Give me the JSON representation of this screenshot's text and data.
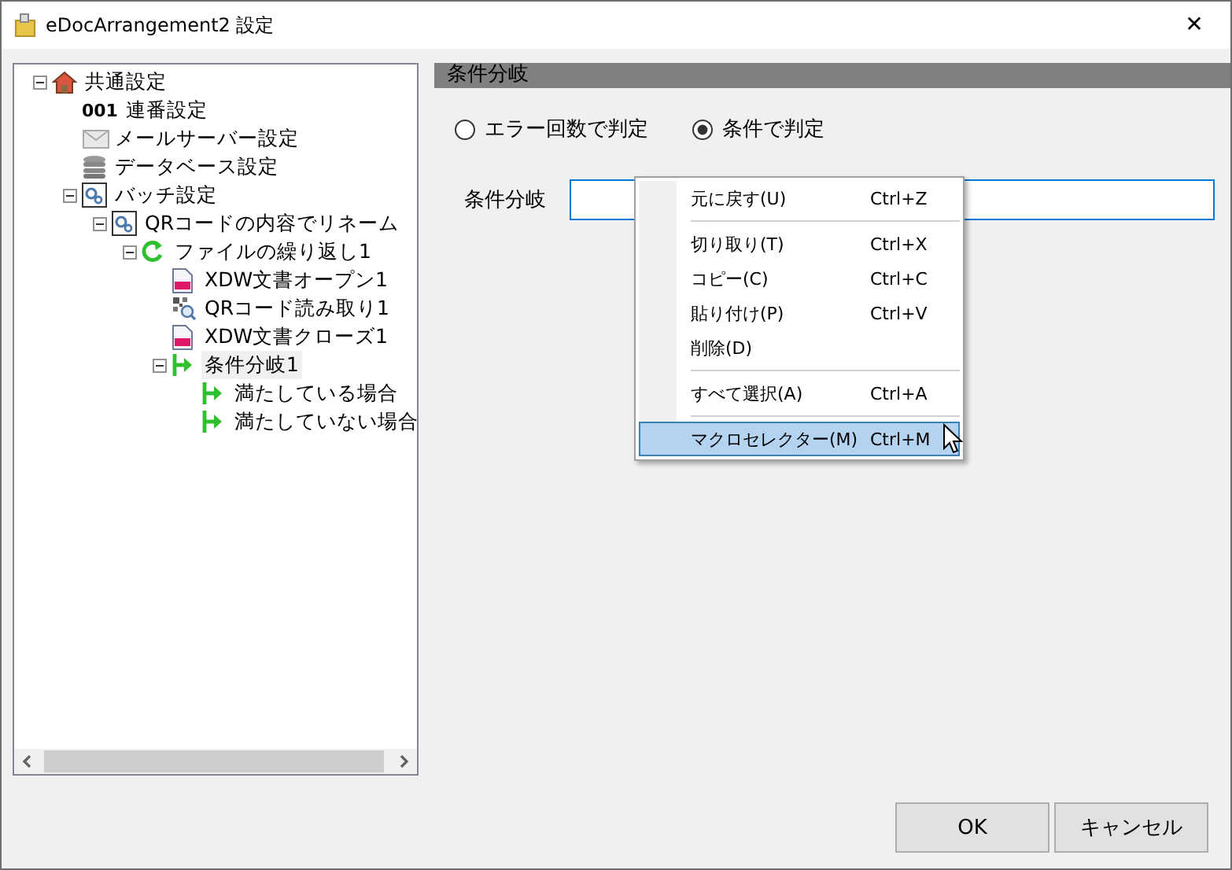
{
  "window": {
    "title": "eDocArrangement2 設定",
    "close": "✕"
  },
  "tree": [
    {
      "label": "共通設定",
      "kind": "home",
      "expanded": true,
      "selected": false,
      "children": [
        {
          "label": "連番設定",
          "kind": "sequence",
          "badge": "001",
          "selected": false
        },
        {
          "label": "メールサーバー設定",
          "kind": "mail",
          "selected": false
        },
        {
          "label": "データベース設定",
          "kind": "database",
          "selected": false
        },
        {
          "label": "バッチ設定",
          "kind": "batch",
          "expanded": true,
          "selected": false,
          "children": [
            {
              "label": "QRコードの内容でリネーム",
              "kind": "batch",
              "expanded": true,
              "selected": false,
              "children": [
                {
                  "label": "ファイルの繰り返し1",
                  "kind": "loop",
                  "expanded": true,
                  "selected": false,
                  "children": [
                    {
                      "label": "XDW文書オープン1",
                      "kind": "document",
                      "selected": false
                    },
                    {
                      "label": "QRコード読み取り1",
                      "kind": "qr",
                      "selected": false
                    },
                    {
                      "label": "XDW文書クローズ1",
                      "kind": "document",
                      "selected": false
                    },
                    {
                      "label": "条件分岐1",
                      "kind": "branch",
                      "expanded": true,
                      "selected": true,
                      "children": [
                        {
                          "label": "満たしている場合",
                          "kind": "branch",
                          "selected": false
                        },
                        {
                          "label": "満たしていない場合",
                          "kind": "branch",
                          "selected": false
                        }
                      ]
                    }
                  ]
                }
              ]
            }
          ]
        }
      ]
    }
  ],
  "panel": {
    "title": "条件分岐",
    "radios": [
      {
        "label": "エラー回数で判定",
        "selected": false
      },
      {
        "label": "条件で判定",
        "selected": true
      }
    ],
    "field": {
      "label": "条件分岐"
    }
  },
  "context_menu": [
    {
      "kind": "item",
      "label": "元に戻す(U)",
      "shortcut": "Ctrl+Z",
      "selected": false
    },
    {
      "kind": "separator"
    },
    {
      "kind": "item",
      "label": "切り取り(T)",
      "shortcut": "Ctrl+X",
      "selected": false
    },
    {
      "kind": "item",
      "label": "コピー(C)",
      "shortcut": "Ctrl+C",
      "selected": false
    },
    {
      "kind": "item",
      "label": "貼り付け(P)",
      "shortcut": "Ctrl+V",
      "selected": false
    },
    {
      "kind": "item",
      "label": "削除(D)",
      "selected": false
    },
    {
      "kind": "separator"
    },
    {
      "kind": "item",
      "label": "すべて選択(A)",
      "shortcut": "Ctrl+A",
      "selected": false
    },
    {
      "kind": "separator"
    },
    {
      "kind": "item",
      "label": "マクロセレクター(M)",
      "shortcut": "Ctrl+M",
      "selected": true
    }
  ],
  "buttons": [
    "OK",
    "キャンセル"
  ]
}
